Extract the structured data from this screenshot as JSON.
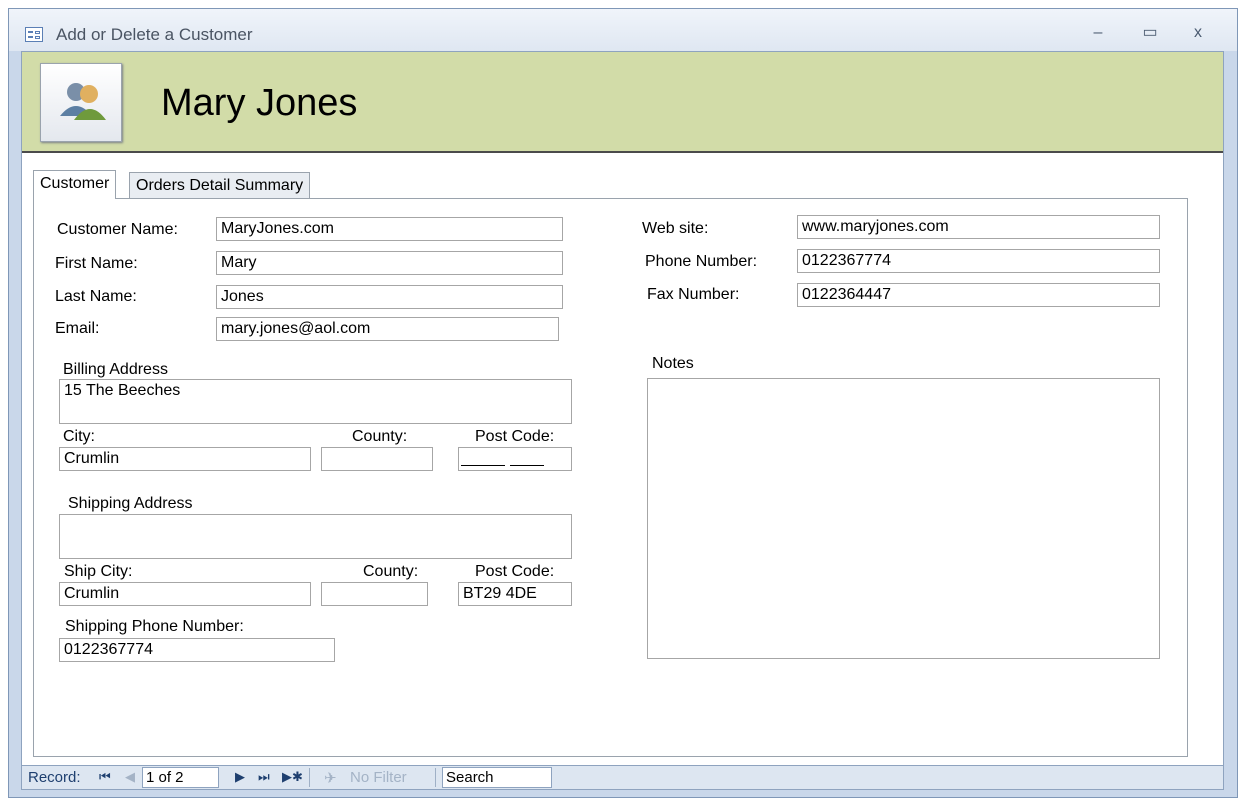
{
  "window": {
    "title": "Add or Delete a Customer",
    "minimize": "–",
    "maximize": "▭",
    "close": "x"
  },
  "header": {
    "title": "Mary Jones",
    "icon": "customers-icon"
  },
  "tabs": [
    {
      "label": "Customer",
      "active": true
    },
    {
      "label": "Orders Detail Summary",
      "active": false
    }
  ],
  "customer": {
    "customer_name_label": "Customer Name:",
    "customer_name": "MaryJones.com",
    "first_name_label": "First Name:",
    "first_name": "Mary",
    "last_name_label": "Last Name:",
    "last_name": "Jones",
    "email_label": "Email:",
    "email": "mary.jones@aol.com",
    "billing_address_label": "Billing Address",
    "billing_address": "15 The Beeches",
    "city_label": "City:",
    "city": "Crumlin",
    "county_label": "County:",
    "county": "",
    "post_code_label": "Post Code:",
    "post_code": "",
    "shipping_address_label": "Shipping Address",
    "shipping_address": "",
    "ship_city_label": "Ship City:",
    "ship_city": "Crumlin",
    "ship_county_label": "County:",
    "ship_county": "",
    "ship_post_code_label": "Post Code:",
    "ship_post_code": "BT29 4DE",
    "shipping_phone_label": "Shipping Phone Number:",
    "shipping_phone": "0122367774",
    "web_site_label": "Web site:",
    "web_site": "www.maryjones.com",
    "phone_label": "Phone Number:",
    "phone": "0122367774",
    "fax_label": "Fax Number:",
    "fax": "0122364447",
    "notes_label": "Notes",
    "notes": ""
  },
  "navbar": {
    "record_label": "Record:",
    "first": "⏮",
    "prev": "◀",
    "position": "1 of 2",
    "next": "▶",
    "last": "⏭",
    "new": "▶✱",
    "filter_label": "No Filter",
    "search_label": "Search"
  },
  "colors": {
    "header_bg": "#d2dca8",
    "nav_text": "#1e3f6f"
  }
}
